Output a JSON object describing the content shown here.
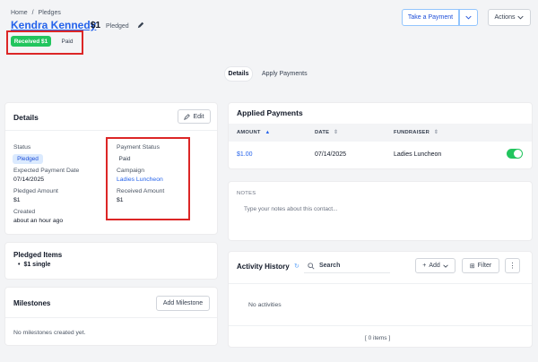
{
  "breadcrumb": {
    "home": "Home",
    "sep": "/",
    "current": "Pledges"
  },
  "header": {
    "name": "Kendra Kennedy",
    "amount": "$1",
    "status": "Pledged",
    "badge_received": "Received $1",
    "badge_paid": "Paid",
    "take_payment": "Take a Payment",
    "actions": "Actions"
  },
  "tabs": {
    "details": "Details",
    "apply_payments": "Apply Payments"
  },
  "details_card": {
    "title": "Details",
    "edit": "Edit",
    "status_label": "Status",
    "status_value": "Pledged",
    "expected_label": "Expected Payment Date",
    "expected_value": "07/14/2025",
    "pledged_amount_label": "Pledged Amount",
    "pledged_amount_value": "$1",
    "created_label": "Created",
    "created_value": "about an hour ago",
    "payment_status_label": "Payment Status",
    "payment_status_value": "Paid",
    "campaign_label": "Campaign",
    "campaign_value": "Ladies Luncheon",
    "received_label": "Received Amount",
    "received_value": "$1"
  },
  "pledged_items": {
    "title": "Pledged Items",
    "items": [
      "$1 single"
    ]
  },
  "milestones": {
    "title": "Milestones",
    "add": "Add Milestone",
    "empty": "No milestones created yet."
  },
  "applied_payments": {
    "title": "Applied Payments",
    "columns": [
      "AMOUNT",
      "DATE",
      "FUNDRAISER"
    ],
    "rows": [
      {
        "amount": "$1.00",
        "date": "07/14/2025",
        "fundraiser": "Ladies Luncheon",
        "toggle_on": true
      }
    ]
  },
  "notes": {
    "label": "NOTES",
    "placeholder": "Type your notes about this contact..."
  },
  "activity": {
    "title": "Activity History",
    "search_placeholder": "Search",
    "add": "Add",
    "filter": "Filter",
    "empty": "No activities",
    "footer": "[ 0 items ]"
  },
  "colors": {
    "accent": "#2563eb",
    "success": "#22c55e",
    "highlight": "#dc2626"
  }
}
